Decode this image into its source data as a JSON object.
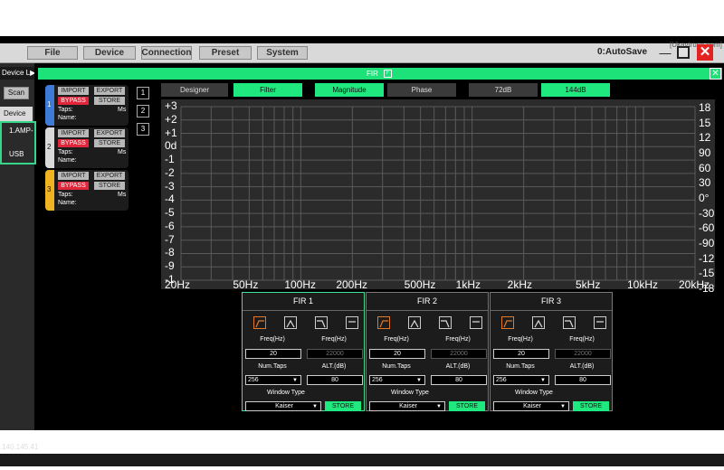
{
  "window": {
    "top_url": "[Ukaytrunx.com]",
    "autosave": "0:AutoSave",
    "minimize": "—",
    "close": "✕"
  },
  "menu": [
    "File",
    "Device",
    "Connection",
    "Preset",
    "System"
  ],
  "left": {
    "device_list_tab": "Device L▶",
    "scan": "Scan",
    "device_tab": "Device",
    "device_item": "1.AMP-",
    "usb": "USB",
    "ip": ".140.145.41"
  },
  "fir_window": {
    "title": "FIR",
    "f_badge": "F",
    "close": "✕"
  },
  "channels": [
    {
      "num": "1",
      "import": "IMPORT",
      "export": "EXPORT",
      "bypass": "BYPASS",
      "store": "STORE",
      "taps": "Taps:",
      "ms": "Ms",
      "name": "Name:",
      "color": "#3d7bd6"
    },
    {
      "num": "2",
      "import": "IMPORT",
      "export": "EXPORT",
      "bypass": "BYPASS",
      "store": "STORE",
      "taps": "Taps:",
      "ms": "Ms",
      "name": "Name:",
      "color": "#d9d9d9"
    },
    {
      "num": "3",
      "import": "IMPORT",
      "export": "EXPORT",
      "bypass": "BYPASS",
      "store": "STORE",
      "taps": "Taps:",
      "ms": "Ms",
      "name": "Name:",
      "color": "#f0b322"
    }
  ],
  "number_buttons": [
    "1",
    "2",
    "3"
  ],
  "top_buttons": {
    "designer": "Designer",
    "filter": "Filter",
    "magnitude": "Magnitude",
    "phase": "Phase",
    "db72": "72dB",
    "db144": "144dB"
  },
  "graph": {
    "y_labels": [
      "+3",
      "+2",
      "+1",
      "0d",
      "-1",
      "-2",
      "-3",
      "-4",
      "-5",
      "-6",
      "-7",
      "-8",
      "-9",
      "-1"
    ],
    "right_labels": [
      "18",
      "15",
      "12",
      "90",
      "60",
      "30",
      "0°",
      "-30",
      "-60",
      "-90",
      "-12",
      "-15",
      "-18"
    ],
    "x_labels": [
      "20Hz",
      "50Hz",
      "100Hz",
      "200Hz",
      "500Hz",
      "1kHz",
      "2kHz",
      "5kHz",
      "10kHz",
      "20kHz"
    ],
    "grid_color": "#5a5a5a"
  },
  "fir_panels": [
    {
      "title": "FIR 1",
      "freq_label_a": "Freq(Hz)",
      "freq_label_b": "Freq(Hz)",
      "freq_a": "20",
      "freq_b": "22000",
      "taps_label": "Num.Taps",
      "alt_label": "ALT.(dB)",
      "taps": "256",
      "alt": "80",
      "window_label": "Window Type",
      "window": "Kaiser",
      "store": "STORE"
    },
    {
      "title": "FIR 2",
      "freq_label_a": "Freq(Hz)",
      "freq_label_b": "Freq(Hz)",
      "freq_a": "20",
      "freq_b": "22000",
      "taps_label": "Num.Taps",
      "alt_label": "ALT.(dB)",
      "taps": "256",
      "alt": "80",
      "window_label": "Window Type",
      "window": "Kaiser",
      "store": "STORE"
    },
    {
      "title": "FIR 3",
      "freq_label_a": "Freq(Hz)",
      "freq_label_b": "Freq(Hz)",
      "freq_a": "20",
      "freq_b": "22000",
      "taps_label": "Num.Taps",
      "alt_label": "ALT.(dB)",
      "taps": "256",
      "alt": "80",
      "window_label": "Window Type",
      "window": "Kaiser",
      "store": "STORE"
    }
  ],
  "filter_icons": [
    "highpass-icon",
    "bandpass-icon",
    "lowpass-icon",
    "flat-icon"
  ]
}
